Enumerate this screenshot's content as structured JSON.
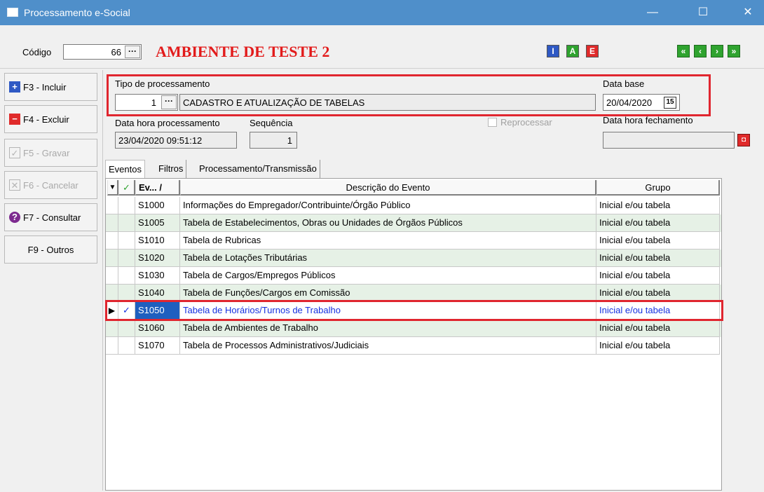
{
  "window": {
    "title": "Processamento e-Social",
    "minimize_glyph": "—",
    "maximize_glyph": "☐",
    "close_glyph": "✕"
  },
  "header": {
    "codigo_label": "Código",
    "codigo_value": "66",
    "ambiente_text": "AMBIENTE DE TESTE 2",
    "mode_buttons": [
      "I",
      "A",
      "E"
    ],
    "nav_buttons": [
      "«",
      "‹",
      "›",
      "»"
    ]
  },
  "sidebar": {
    "items": [
      {
        "label": "F3 - Incluir",
        "icon": "plus-icon",
        "enabled": true
      },
      {
        "label": "F4 - Excluir",
        "icon": "minus-icon",
        "enabled": true
      },
      {
        "label": "F5 - Gravar",
        "icon": "check-icon",
        "enabled": false
      },
      {
        "label": "F6 - Cancelar",
        "icon": "x-icon",
        "enabled": false
      },
      {
        "label": "F7 - Consultar",
        "icon": "question-icon",
        "enabled": true
      },
      {
        "label": "F9 - Outros",
        "icon": "",
        "enabled": true
      }
    ]
  },
  "form": {
    "tipo_label": "Tipo de processamento",
    "tipo_code": "1",
    "tipo_desc": "CADASTRO E ATUALIZAÇÃO DE TABELAS",
    "data_base_label": "Data base",
    "data_base_value": "20/04/2020",
    "calendar_glyph": "15",
    "data_hora_proc_label": "Data hora processamento",
    "data_hora_proc_value": "23/04/2020 09:51:12",
    "sequencia_label": "Sequência",
    "sequencia_value": "1",
    "reprocessar_label": "Reprocessar",
    "data_hora_fech_label": "Data hora fechamento",
    "data_hora_fech_value": ""
  },
  "tabs": [
    "Eventos",
    "Filtros",
    "Processamento/Transmissão"
  ],
  "grid": {
    "headers": {
      "indicator": "▼",
      "check": "✓",
      "evento": "Ev... /",
      "descricao": "Descrição do Evento",
      "grupo": "Grupo"
    },
    "rows": [
      {
        "code": "S1000",
        "desc": "Informações do Empregador/Contribuinte/Órgão Público",
        "grupo": "Inicial e/ou tabela"
      },
      {
        "code": "S1005",
        "desc": "Tabela de Estabelecimentos, Obras ou Unidades de Órgãos Públicos",
        "grupo": "Inicial e/ou tabela"
      },
      {
        "code": "S1010",
        "desc": "Tabela de Rubricas",
        "grupo": "Inicial e/ou tabela"
      },
      {
        "code": "S1020",
        "desc": "Tabela de Lotações Tributárias",
        "grupo": "Inicial e/ou tabela"
      },
      {
        "code": "S1030",
        "desc": "Tabela de Cargos/Empregos Públicos",
        "grupo": "Inicial e/ou tabela"
      },
      {
        "code": "S1040",
        "desc": "Tabela de Funções/Cargos em Comissão",
        "grupo": "Inicial e/ou tabela"
      },
      {
        "code": "S1050",
        "desc": "Tabela de Horários/Turnos de Trabalho",
        "grupo": "Inicial e/ou tabela",
        "selected": true
      },
      {
        "code": "S1060",
        "desc": "Tabela de Ambientes de Trabalho",
        "grupo": "Inicial e/ou tabela"
      },
      {
        "code": "S1070",
        "desc": "Tabela de Processos Administrativos/Judiciais",
        "grupo": "Inicial e/ou tabela"
      }
    ]
  }
}
